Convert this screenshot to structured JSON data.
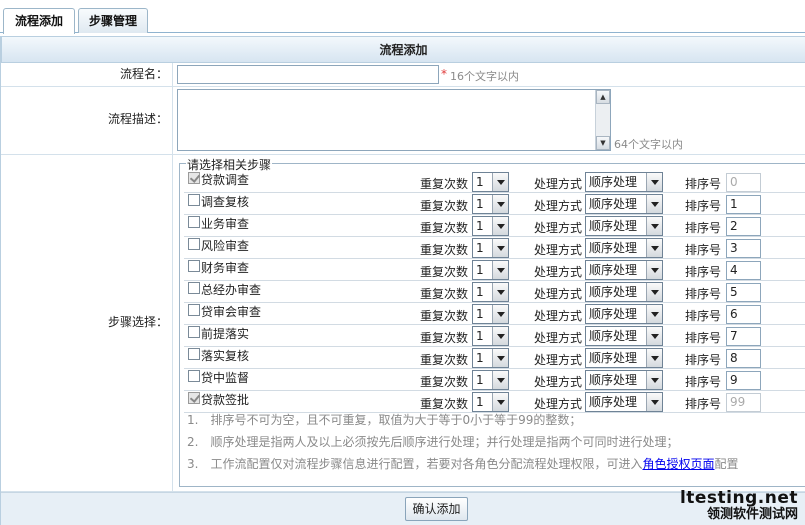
{
  "tabs": [
    {
      "label": "流程添加",
      "active": true
    },
    {
      "label": "步骤管理",
      "active": false
    }
  ],
  "form": {
    "title": "流程添加",
    "name_label": "流程名：",
    "name_value": "",
    "name_required_mark": "*",
    "name_hint": "16个文字以内",
    "desc_label": "流程描述：",
    "desc_value": "",
    "desc_hint": "64个文字以内",
    "steps_label": "步骤选择：",
    "steps_legend": "请选择相关步骤",
    "repeat_label": "重复次数",
    "mode_label": "处理方式",
    "order_label": "排序号",
    "steps": [
      {
        "name": "贷款调查",
        "checked": true,
        "disabled": true,
        "repeat": "1",
        "mode": "顺序处理",
        "order": "0"
      },
      {
        "name": "调查复核",
        "checked": false,
        "disabled": false,
        "repeat": "1",
        "mode": "顺序处理",
        "order": "1"
      },
      {
        "name": "业务审查",
        "checked": false,
        "disabled": false,
        "repeat": "1",
        "mode": "顺序处理",
        "order": "2"
      },
      {
        "name": "风险审查",
        "checked": false,
        "disabled": false,
        "repeat": "1",
        "mode": "顺序处理",
        "order": "3"
      },
      {
        "name": "财务审查",
        "checked": false,
        "disabled": false,
        "repeat": "1",
        "mode": "顺序处理",
        "order": "4"
      },
      {
        "name": "总经办审查",
        "checked": false,
        "disabled": false,
        "repeat": "1",
        "mode": "顺序处理",
        "order": "5"
      },
      {
        "name": "贷审会审查",
        "checked": false,
        "disabled": false,
        "repeat": "1",
        "mode": "顺序处理",
        "order": "6"
      },
      {
        "name": "前提落实",
        "checked": false,
        "disabled": false,
        "repeat": "1",
        "mode": "顺序处理",
        "order": "7"
      },
      {
        "name": "落实复核",
        "checked": false,
        "disabled": false,
        "repeat": "1",
        "mode": "顺序处理",
        "order": "8"
      },
      {
        "name": "贷中监督",
        "checked": false,
        "disabled": false,
        "repeat": "1",
        "mode": "顺序处理",
        "order": "9"
      },
      {
        "name": "贷款签批",
        "checked": true,
        "disabled": true,
        "repeat": "1",
        "mode": "顺序处理",
        "order": "99"
      }
    ],
    "notes": [
      "1.　排序号不可为空，且不可重复，取值为大于等于0小于等于99的整数；",
      "2.　顺序处理是指两人及以上必须按先后顺序进行处理；并行处理是指两个可同时进行处理；"
    ],
    "note3_prefix": "3.　工作流配置仅对流程步骤信息进行配置，若要对各角色分配流程处理权限，可进入",
    "note3_link": "角色授权页面",
    "note3_suffix": "配置",
    "submit_label": "确认添加"
  },
  "watermark": {
    "line1": "ltesting.net",
    "line2": "领测软件测试网"
  }
}
